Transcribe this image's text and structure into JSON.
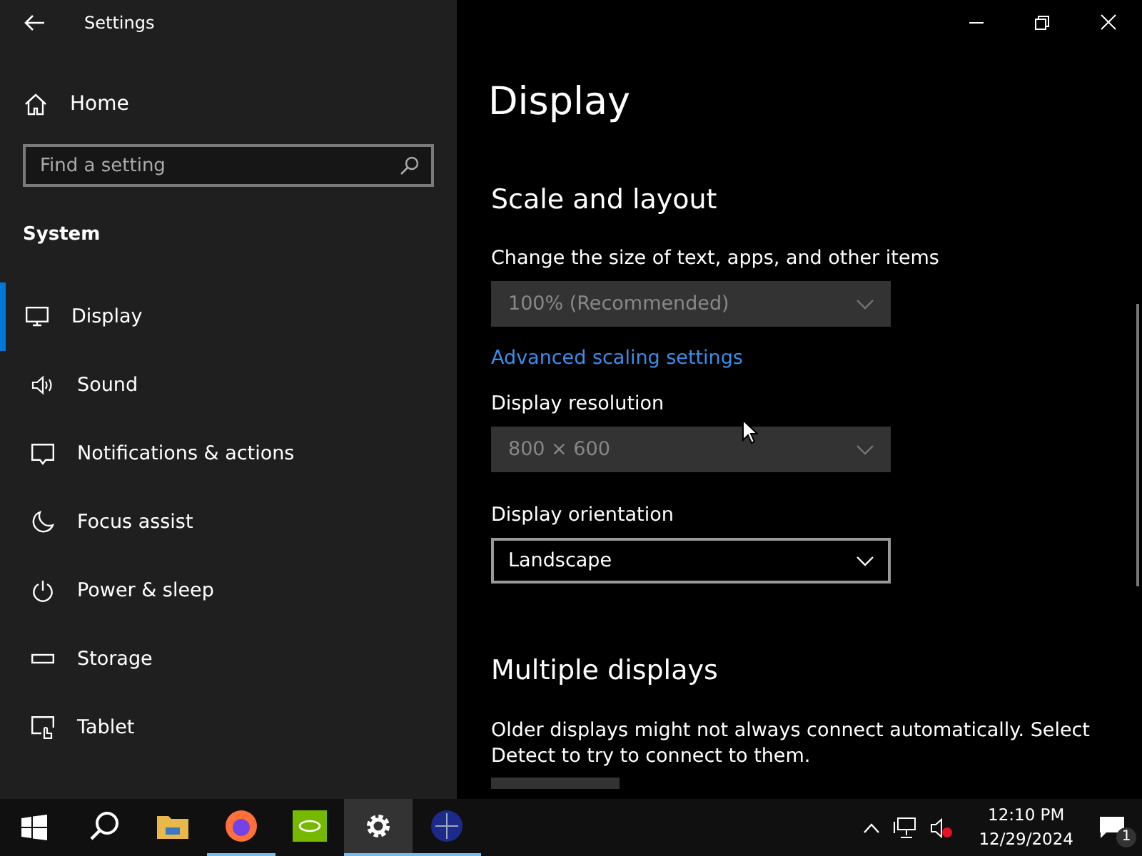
{
  "window": {
    "title": "Settings"
  },
  "sidebar": {
    "home": "Home",
    "search": {
      "placeholder": "Find a setting"
    },
    "section": "System",
    "items": [
      {
        "label": "Display",
        "kind": "monitor",
        "selected": true
      },
      {
        "label": "Sound",
        "kind": "speaker",
        "selected": false
      },
      {
        "label": "Notifications & actions",
        "kind": "message",
        "selected": false
      },
      {
        "label": "Focus assist",
        "kind": "moon",
        "selected": false
      },
      {
        "label": "Power & sleep",
        "kind": "power",
        "selected": false
      },
      {
        "label": "Storage",
        "kind": "storage",
        "selected": false
      },
      {
        "label": "Tablet",
        "kind": "tablet",
        "selected": false
      }
    ]
  },
  "content": {
    "title": "Display",
    "section": "Scale and layout",
    "fields": [
      {
        "kind": "dropdown",
        "label": "Change the size of text, apps, and other items",
        "value": "100% (Recommended)",
        "disabled": true
      },
      {
        "kind": "link",
        "label": "Advanced scaling settings"
      },
      {
        "kind": "dropdown",
        "label": "Display resolution",
        "value": "800 × 600",
        "disabled": true
      },
      {
        "kind": "dropdown",
        "label": "Display orientation",
        "value": "Landscape",
        "disabled": false
      }
    ],
    "section2": "Multiple displays",
    "description": "Older displays might not always connect automatically. Select Detect to try to connect to them."
  },
  "taskbar": {
    "apps": [
      {
        "kind": "search",
        "active": false,
        "selected": false
      },
      {
        "kind": "folder",
        "active": false,
        "selected": false
      },
      {
        "kind": "browser",
        "active": true,
        "selected": false
      },
      {
        "kind": "gpu",
        "active": false,
        "selected": false
      },
      {
        "kind": "gear",
        "active": true,
        "selected": true
      },
      {
        "kind": "globe",
        "active": true,
        "selected": false
      }
    ],
    "time": "12:10 PM",
    "date": "12/29/2024",
    "notifications": "1"
  }
}
